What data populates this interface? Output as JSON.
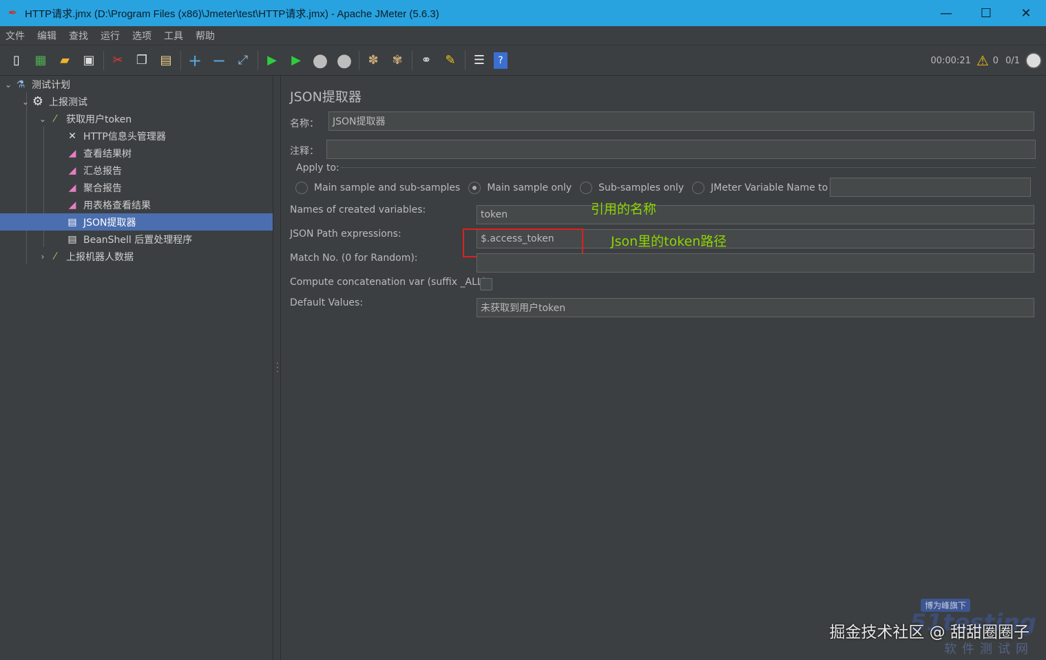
{
  "window": {
    "title": "HTTP请求.jmx (D:\\Program Files (x86)\\Jmeter\\test\\HTTP请求.jmx) - Apache JMeter (5.6.3)",
    "minimize": "—",
    "maximize": "☐",
    "close": "✕"
  },
  "menu": [
    "文件",
    "编辑",
    "查找",
    "运行",
    "选项",
    "工具",
    "帮助"
  ],
  "status": {
    "elapsed": "00:00:21",
    "warnings": "0",
    "threads": "0/1"
  },
  "tree": {
    "items": [
      {
        "label": "测试计划",
        "icon": "test-plan-icon"
      },
      {
        "label": "上报测试",
        "icon": "thread-group-gear-icon"
      },
      {
        "label": "获取用户token",
        "icon": "sampler-pipette-icon"
      },
      {
        "label": "HTTP信息头管理器",
        "icon": "config-tools-icon"
      },
      {
        "label": "查看结果树",
        "icon": "listener-chart-icon"
      },
      {
        "label": "汇总报告",
        "icon": "listener-chart-icon"
      },
      {
        "label": "聚合报告",
        "icon": "listener-chart-icon"
      },
      {
        "label": "用表格查看结果",
        "icon": "listener-chart-icon"
      },
      {
        "label": "JSON提取器",
        "icon": "post-processor-icon"
      },
      {
        "label": "BeanShell 后置处理程序",
        "icon": "post-processor-icon"
      },
      {
        "label": "上报机器人数据",
        "icon": "sampler-pipette-icon"
      }
    ]
  },
  "panel": {
    "title": "JSON提取器",
    "name_label": "名称：",
    "name_value": "JSON提取器",
    "comment_label": "注释：",
    "comment_value": "",
    "apply_to_label": "Apply to:",
    "apply_options": [
      "Main sample and sub-samples",
      "Main sample only",
      "Sub-samples only",
      "JMeter Variable Name to use"
    ],
    "apply_selected": "Main sample only",
    "jmeter_var_value": "",
    "vars_label": "Names of created variables:",
    "vars_value": "token",
    "path_label": "JSON Path expressions:",
    "path_value": "$.access_token",
    "match_label": "Match No. (0 for Random):",
    "match_value": "",
    "concat_label": "Compute concatenation var (suffix _ALL):",
    "concat_checked": false,
    "default_label": "Default Values:",
    "default_value": "未获取到用户token"
  },
  "annotations": {
    "vars_note": "引用的名称",
    "path_note": "Json里的token路径",
    "color": "#8ed600",
    "box_color": "#e02020"
  },
  "watermark": {
    "main": "掘金技术社区 @ 甜甜圈圈子",
    "site": "51testing",
    "badge": "博为峰旗下",
    "sub": "软件测试网"
  },
  "colors": {
    "titlebar": "#29a3e0",
    "background": "#3c3f41",
    "selection": "#4b6eaf"
  }
}
